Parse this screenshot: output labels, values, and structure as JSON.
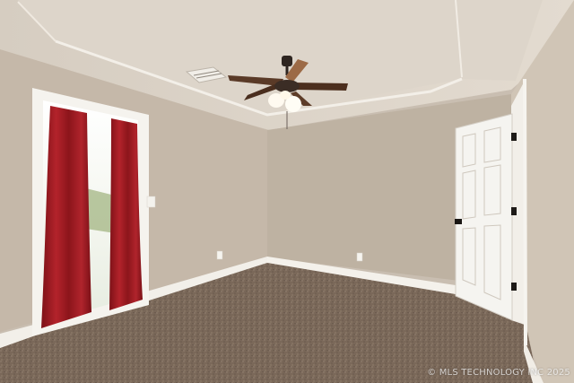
{
  "photo": {
    "watermark": "© MLS TECHNOLOGY INC 2025"
  },
  "colors": {
    "wall_left": "#c6b9aa",
    "wall_back": "#bfb3a3",
    "wall_right": "#d2c7b9",
    "ceiling": "#ddd4c8",
    "carpet": "#7c6a5c",
    "curtain": "#9e1b22",
    "trim": "#f5f3ee",
    "door": "#f4f3ef"
  },
  "icons": {
    "fan": "ceiling-fan-icon",
    "vent": "air-vent-icon",
    "outlet": "power-outlet-icon"
  }
}
